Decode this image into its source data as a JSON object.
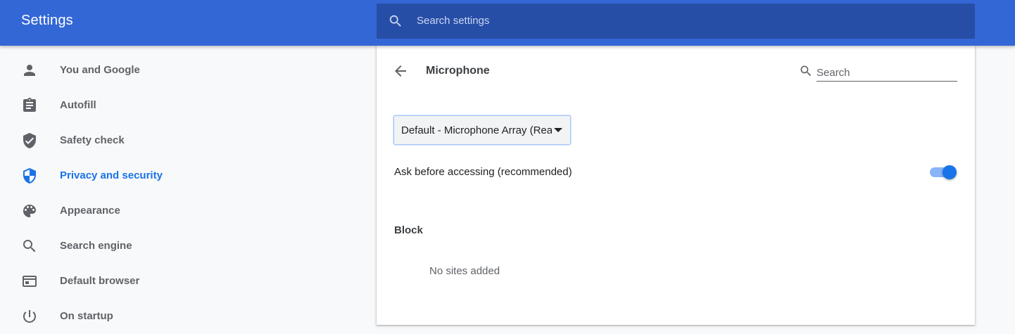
{
  "header": {
    "title": "Settings",
    "search_placeholder": "Search settings"
  },
  "sidebar": {
    "items": [
      {
        "label": "You and Google",
        "icon": "person-icon",
        "active": false
      },
      {
        "label": "Autofill",
        "icon": "clipboard-icon",
        "active": false
      },
      {
        "label": "Safety check",
        "icon": "shield-check-icon",
        "active": false
      },
      {
        "label": "Privacy and security",
        "icon": "shield-icon",
        "active": true
      },
      {
        "label": "Appearance",
        "icon": "palette-icon",
        "active": false
      },
      {
        "label": "Search engine",
        "icon": "search-icon",
        "active": false
      },
      {
        "label": "Default browser",
        "icon": "browser-window-icon",
        "active": false
      },
      {
        "label": "On startup",
        "icon": "power-icon",
        "active": false
      }
    ]
  },
  "content": {
    "back_icon": "arrow-back-icon",
    "title": "Microphone",
    "search_placeholder": "Search",
    "device_select_value": "Default - Microphone Array (Realtek(R) Audio)",
    "ask_label": "Ask before accessing (recommended)",
    "ask_enabled": true,
    "block_title": "Block",
    "block_empty": "No sites added"
  },
  "colors": {
    "header_bg": "#3367d6",
    "search_bg": "#274ea6",
    "accent": "#1a73e8",
    "page_bg": "#f8f9fa"
  }
}
